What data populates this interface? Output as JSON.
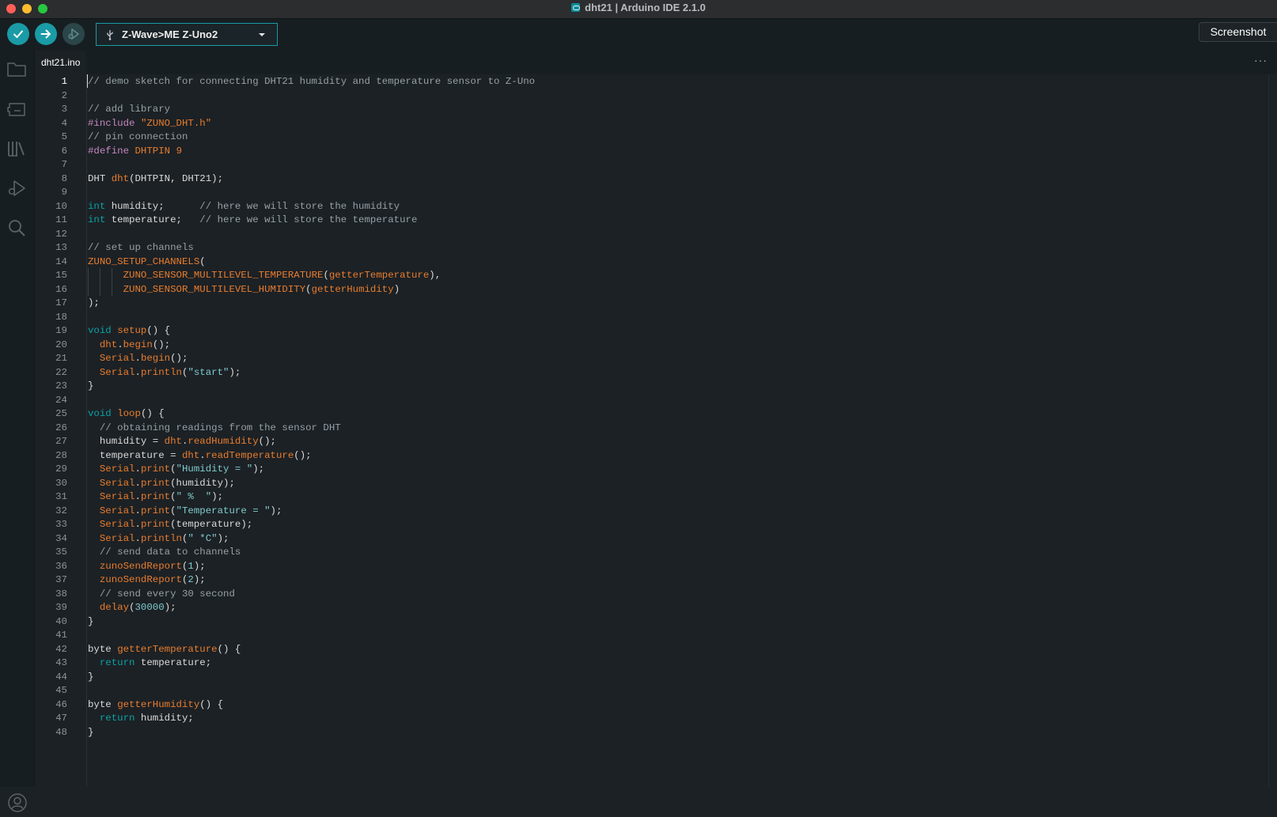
{
  "window": {
    "title": "dht21 | Arduino IDE 2.1.0"
  },
  "toolbar": {
    "verify_icon": "checkmark-icon",
    "upload_icon": "arrow-right-icon",
    "debug_icon": "debugger-icon",
    "board": "Z-Wave>ME Z-Uno2",
    "screenshot_label": "Screenshot"
  },
  "sidebar": {
    "items": [
      "folder-icon",
      "board-manager-icon",
      "library-manager-icon",
      "debug-icon",
      "search-icon"
    ],
    "profile_icon": "account-icon"
  },
  "tabs": [
    {
      "label": "dht21.ino",
      "active": true
    }
  ],
  "more_label": "···",
  "editor": {
    "active_line": 1,
    "lines": [
      "// demo sketch for connecting DHT21 humidity and temperature sensor to Z-Uno",
      "",
      "// add library",
      "#include \"ZUNO_DHT.h\"",
      "// pin connection",
      "#define DHTPIN 9",
      "",
      "DHT dht(DHTPIN, DHT21);",
      "",
      "int humidity;      // here we will store the humidity",
      "int temperature;   // here we will store the temperature",
      "",
      "// set up channels",
      "ZUNO_SETUP_CHANNELS(",
      "      ZUNO_SENSOR_MULTILEVEL_TEMPERATURE(getterTemperature),",
      "      ZUNO_SENSOR_MULTILEVEL_HUMIDITY(getterHumidity)",
      ");",
      "",
      "void setup() {",
      "  dht.begin();",
      "  Serial.begin();",
      "  Serial.println(\"start\");",
      "}",
      "",
      "void loop() {",
      "  // obtaining readings from the sensor DHT",
      "  humidity = dht.readHumidity();",
      "  temperature = dht.readTemperature();",
      "  Serial.print(\"Humidity = \");",
      "  Serial.print(humidity);",
      "  Serial.print(\" %  \");",
      "  Serial.print(\"Temperature = \");",
      "  Serial.print(temperature);",
      "  Serial.println(\" *C\");",
      "  // send data to channels",
      "  zunoSendReport(1);",
      "  zunoSendReport(2);",
      "  // send every 30 second",
      "  delay(30000);",
      "}",
      "",
      "byte getterTemperature() {",
      "  return temperature;",
      "}",
      "",
      "byte getterHumidity() {",
      "  return humidity;",
      "}"
    ]
  },
  "colors": {
    "accent": "#1a9ba6",
    "keyword_type": "#0ca1a6",
    "preprocessor": "#c586c0",
    "function": "#e97d2e",
    "string": "#7fcbcd",
    "comment": "#95a0a6",
    "number": "#7fcbcd",
    "text": "#dadada"
  }
}
